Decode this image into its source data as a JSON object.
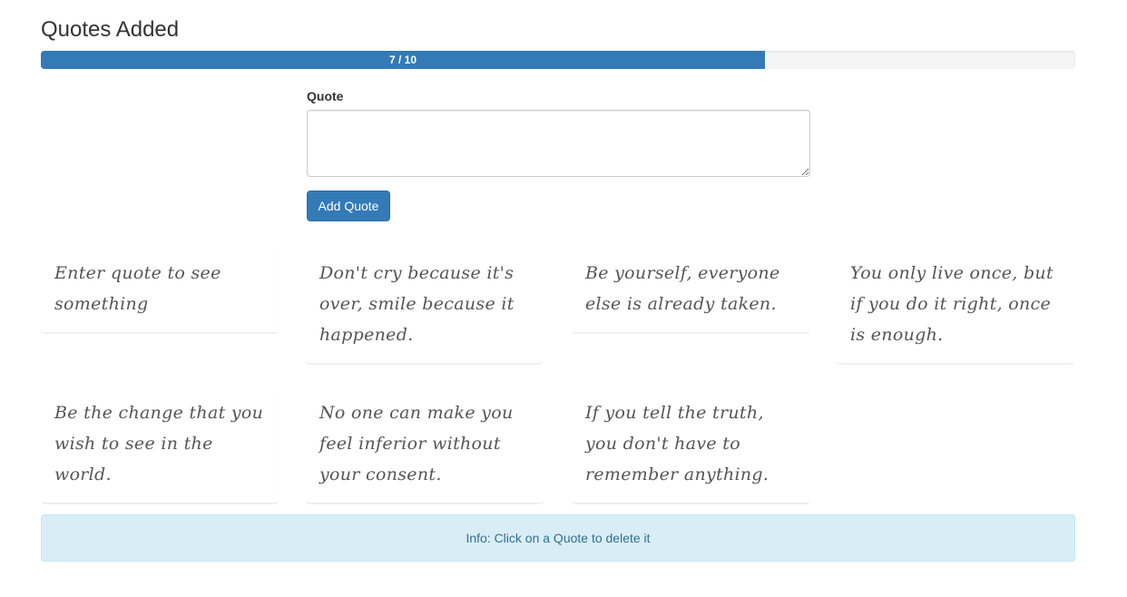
{
  "header": {
    "title": "Quotes Added"
  },
  "progress": {
    "label": "7 / 10",
    "current": 7,
    "max": 10
  },
  "form": {
    "label": "Quote",
    "textarea_value": "",
    "button_label": "Add Quote"
  },
  "quotes": [
    "Enter quote to see something",
    "Don't cry because it's over, smile because it happened.",
    "Be yourself, everyone else is already taken.",
    "You only live once, but if you do it right, once is enough.",
    "Be the change that you wish to see in the world.",
    "No one can make you feel inferior without your consent.",
    "If you tell the truth, you don't have to remember anything."
  ],
  "info": {
    "text": "Info: Click on a Quote to delete it"
  },
  "colors": {
    "primary": "#337ab7",
    "info_bg": "#d9edf7",
    "info_text": "#31708f"
  }
}
